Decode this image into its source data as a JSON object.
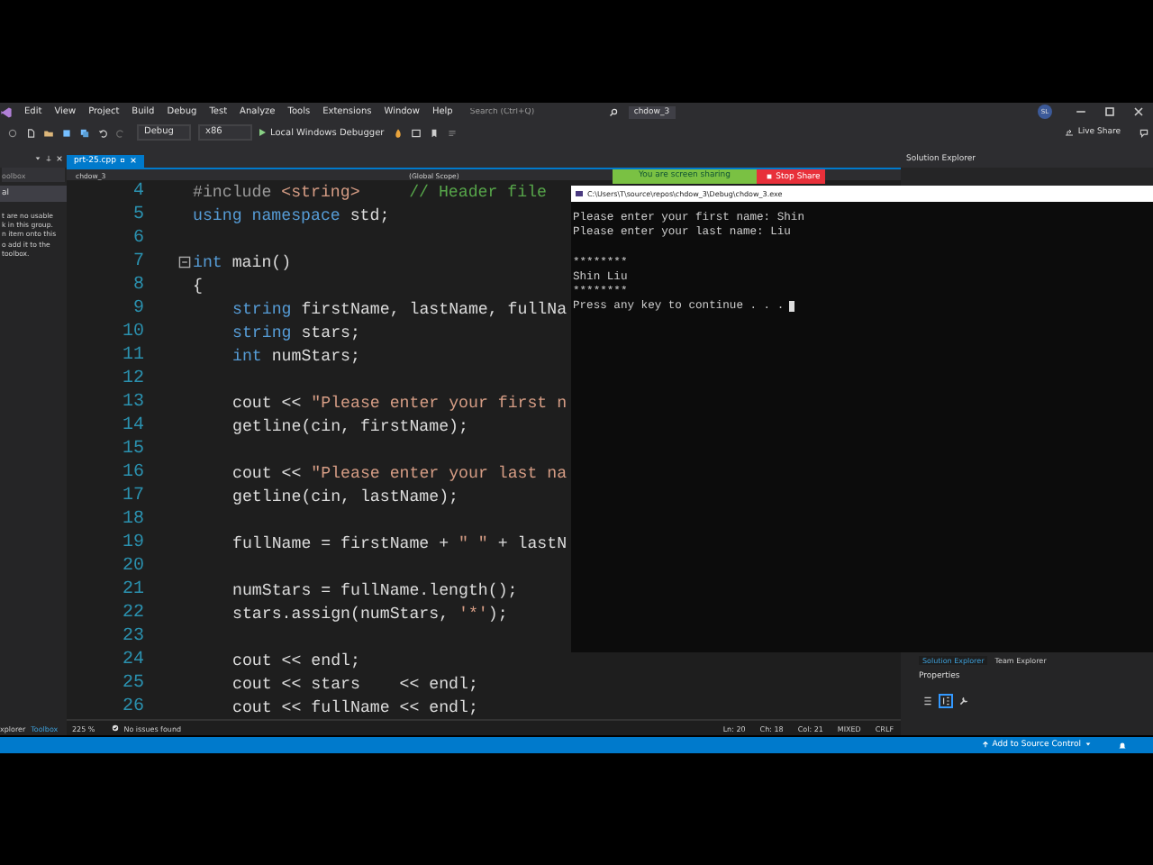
{
  "menu_bar": {
    "items": [
      "Edit",
      "View",
      "Project",
      "Build",
      "Debug",
      "Test",
      "Analyze",
      "Tools",
      "Extensions",
      "Window",
      "Help"
    ],
    "search": {
      "placeholder": "Search (Ctrl+Q)"
    },
    "solution_name": "chdow_3",
    "user_initials": "SL"
  },
  "toolbar": {
    "configuration": "Debug",
    "platform": "x86",
    "debugger": "Local Windows Debugger",
    "live_share": "Live Share"
  },
  "screen_share": {
    "status": "You are screen sharing",
    "stop": "Stop Share"
  },
  "toolbox": {
    "search": {
      "placeholder": "oolbox"
    },
    "group": "al",
    "message_lines": [
      "t are no usable",
      "k in this group.",
      "n item onto this",
      "o add it to the",
      "toolbox."
    ],
    "bottom_tabs": [
      {
        "label": "xplorer",
        "selected": false
      },
      {
        "label": "Toolbox",
        "selected": true
      }
    ]
  },
  "editor": {
    "tabs": [
      {
        "label": "prt-25.cpp",
        "selected": true
      }
    ],
    "project": "chdow_3",
    "scope": "(Global Scope)",
    "lines": [
      {
        "number": "4",
        "indented": false,
        "fold": false,
        "tokens": [
          {
            "kind": "pp",
            "text": "#include"
          },
          {
            "kind": "str",
            "text": " <string>"
          },
          {
            "kind": "comment",
            "text": "     // Header file"
          }
        ]
      },
      {
        "number": "5",
        "indented": false,
        "fold": false,
        "tokens": [
          {
            "kind": "kw",
            "text": "using"
          },
          {
            "kind": "kw",
            "text": " namespace"
          },
          {
            "kind": "plain",
            "text": " std;"
          }
        ]
      },
      {
        "number": "6",
        "fold": false
      },
      {
        "number": "7",
        "indented": false,
        "fold": true,
        "tokens": [
          {
            "kind": "kw",
            "text": "int"
          },
          {
            "kind": "plain",
            "text": " main()"
          }
        ]
      },
      {
        "number": "8",
        "indented": false,
        "fold": false,
        "tokens": [
          {
            "kind": "plain",
            "text": "{"
          }
        ]
      },
      {
        "number": "9",
        "indented": true,
        "fold": false,
        "tokens": [
          {
            "kind": "kw",
            "text": "string"
          },
          {
            "kind": "plain",
            "text": " firstName, lastName, fullNa"
          }
        ]
      },
      {
        "number": "10",
        "indented": true,
        "fold": false,
        "tokens": [
          {
            "kind": "kw",
            "text": "string"
          },
          {
            "kind": "plain",
            "text": " stars;"
          }
        ]
      },
      {
        "number": "11",
        "indented": true,
        "fold": false,
        "tokens": [
          {
            "kind": "kw",
            "text": "int"
          },
          {
            "kind": "plain",
            "text": " numStars;"
          }
        ]
      },
      {
        "number": "12",
        "fold": false
      },
      {
        "number": "13",
        "indented": true,
        "fold": false,
        "tokens": [
          {
            "kind": "plain",
            "text": "cout << "
          },
          {
            "kind": "str",
            "text": "\"Please enter your first n"
          }
        ]
      },
      {
        "number": "14",
        "indented": true,
        "fold": false,
        "tokens": [
          {
            "kind": "plain",
            "text": "getline(cin, firstName);"
          }
        ]
      },
      {
        "number": "15",
        "fold": false
      },
      {
        "number": "16",
        "indented": true,
        "fold": false,
        "tokens": [
          {
            "kind": "plain",
            "text": "cout << "
          },
          {
            "kind": "str",
            "text": "\"Please enter your last na"
          }
        ]
      },
      {
        "number": "17",
        "indented": true,
        "fold": false,
        "tokens": [
          {
            "kind": "plain",
            "text": "getline(cin, lastName);"
          }
        ]
      },
      {
        "number": "18",
        "fold": false
      },
      {
        "number": "19",
        "indented": true,
        "fold": false,
        "tokens": [
          {
            "kind": "plain",
            "text": "fullName = firstName + "
          },
          {
            "kind": "str",
            "text": "\" \""
          },
          {
            "kind": "plain",
            "text": " + lastN"
          }
        ]
      },
      {
        "number": "20",
        "fold": false
      },
      {
        "number": "21",
        "indented": true,
        "fold": false,
        "tokens": [
          {
            "kind": "plain",
            "text": "numStars = fullName.length();"
          }
        ]
      },
      {
        "number": "22",
        "indented": true,
        "fold": false,
        "tokens": [
          {
            "kind": "plain",
            "text": "stars.assign(numStars, "
          },
          {
            "kind": "str",
            "text": "'*'"
          },
          {
            "kind": "plain",
            "text": ");"
          }
        ]
      },
      {
        "number": "23",
        "fold": false
      },
      {
        "number": "24",
        "indented": true,
        "fold": false,
        "tokens": [
          {
            "kind": "plain",
            "text": "cout << endl;"
          }
        ]
      },
      {
        "number": "25",
        "indented": true,
        "fold": false,
        "tokens": [
          {
            "kind": "plain",
            "text": "cout << stars    << endl;"
          }
        ]
      },
      {
        "number": "26",
        "indented": true,
        "fold": false,
        "tokens": [
          {
            "kind": "plain",
            "text": "cout << fullName << endl;"
          }
        ]
      }
    ],
    "status": {
      "zoom": "225 %",
      "issues": "No issues found",
      "line": "Ln: 20",
      "char": "Ch: 18",
      "col": "Col: 21",
      "whitespace": "MIXED",
      "line_ending": "CRLF"
    }
  },
  "console": {
    "title": "C:\\Users\\T\\source\\repos\\chdow_3\\Debug\\chdow_3.exe",
    "blocks": [
      [
        "Please enter your first name: Shin",
        "Please enter your last name: Liu"
      ],
      [
        "********",
        "Shin Liu",
        "********",
        "Press any key to continue . . ."
      ]
    ]
  },
  "solution_explorer": {
    "title": "Solution Explorer"
  },
  "bottom_panel": {
    "tabs": [
      {
        "label": "Solution Explorer",
        "selected": true
      },
      {
        "label": "Team Explorer",
        "selected": false
      }
    ],
    "properties_title": "Properties"
  },
  "status_bar": {
    "source_control": "Add to Source Control"
  }
}
